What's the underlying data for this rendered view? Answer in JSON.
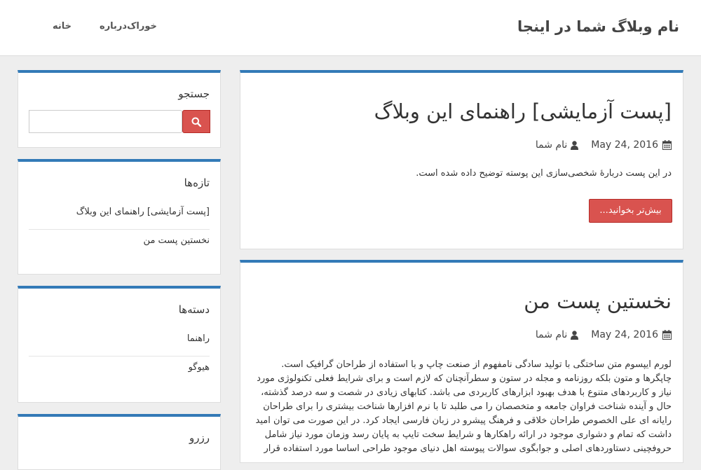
{
  "header": {
    "site_title": "نام وبلاگ شما در اینجا",
    "nav": {
      "home": "خانه",
      "about": "درباره",
      "feed": "خوراک"
    }
  },
  "posts": [
    {
      "title": "[پست آزمایشی] راهنمای این وبلاگ",
      "date": "May 24, 2016",
      "author": "نام شما",
      "summary": "در این پست دربارهٔ شخصی‌سازی این پوسته توضیح داده شده است.",
      "read_more": "بیش‌تر بخوانید..."
    },
    {
      "title": "نخستین پست من",
      "date": "May 24, 2016",
      "author": "نام شما",
      "body": "لورم ایپسوم متن ساختگی با تولید سادگی نامفهوم از صنعت چاپ و با استفاده از طراحان گرافیک است. چاپگرها و متون بلکه روزنامه و مجله در ستون و سطرآنچنان که لازم است و برای شرایط فعلی تکنولوژی مورد نیاز و کاربردهای متنوع با هدف بهبود ابزارهای کاربردی می باشد. کتابهای زیادی در شصت و سه درصد گذشته، حال و آینده شناخت فراوان جامعه و متخصصان را می طلبد تا با نرم افزارها شناخت بیشتری را برای طراحان رایانه ای علی الخصوص طراحان خلاقی و فرهنگ پیشرو در زبان فارسی ایجاد کرد. در این صورت می توان امید داشت که تمام و دشواری موجود در ارائه راهکارها و شرایط سخت تایپ به پایان رسد وزمان مورد نیاز شامل حروفچینی دستاوردهای اصلی و جوابگوی سوالات پیوسته اهل دنیای موجود طراحی اساسا مورد استفاده قرار"
    }
  ],
  "sidebar": {
    "search": {
      "title": "جستجو",
      "placeholder": ""
    },
    "recent": {
      "title": "تازه‌ها",
      "items": [
        "[پست آزمایشی] راهنمای این وبلاگ",
        "نخستین پست من"
      ]
    },
    "categories": {
      "title": "دسته‌ها",
      "items": [
        "راهنما",
        "هیوگو"
      ]
    },
    "archive": {
      "title": "رزرو"
    }
  },
  "colors": {
    "accent_blue": "#337ab7",
    "button_red": "#d9534f"
  },
  "icons": {
    "calendar": "calendar-icon",
    "user": "user-icon",
    "search": "search-icon"
  }
}
